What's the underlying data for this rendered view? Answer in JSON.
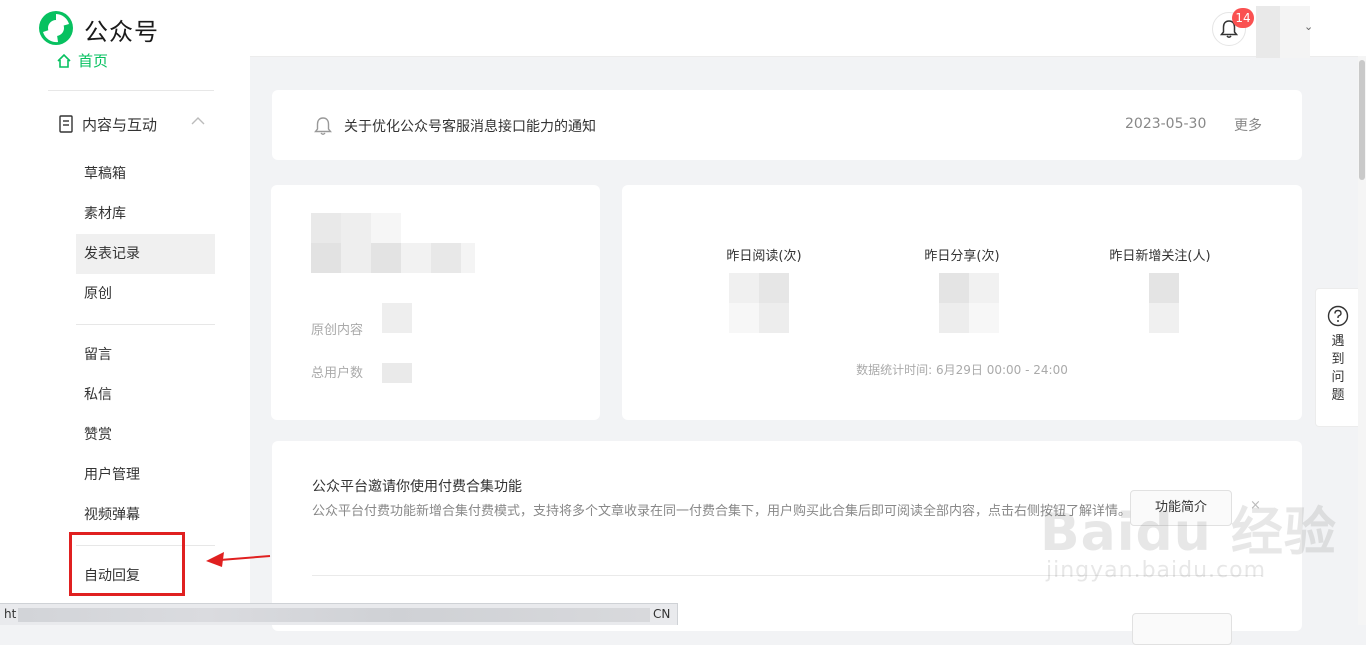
{
  "app": {
    "title": "公众号",
    "brand_color": "#07c160"
  },
  "header": {
    "notification_count": "14"
  },
  "sidebar": {
    "home": "首页",
    "section": "内容与互动",
    "items_group1": [
      "草稿箱",
      "素材库",
      "发表记录",
      "原创"
    ],
    "items_group2": [
      "留言",
      "私信",
      "赞赏",
      "用户管理",
      "视频弹幕"
    ],
    "items_group3": [
      "自动回复"
    ],
    "active_item": "发表记录"
  },
  "notice": {
    "text": "关于优化公众号客服消息接口能力的通知",
    "date": "2023-05-30",
    "more": "更多"
  },
  "profile": {
    "original_label": "原创内容",
    "users_label": "总用户数"
  },
  "stats": {
    "read_label": "昨日阅读(次)",
    "share_label": "昨日分享(次)",
    "follow_label": "昨日新增关注(人)",
    "footer": "数据统计时间: 6月29日 00:00 - 24:00"
  },
  "invite": {
    "title": "公众平台邀请你使用付费合集功能",
    "desc": "公众平台付费功能新增合集付费模式，支持将多个文章收录在同一付费合集下，用户购买此合集后即可阅读全部内容，点击右侧按钮了解详情。",
    "button": "功能简介",
    "close": "×"
  },
  "help": {
    "text": "遇到问题"
  },
  "statusbar": {
    "left": "ht",
    "right": "CN"
  },
  "watermark": {
    "main": "Baidu 经验",
    "sub": "jingyan.baidu.com"
  },
  "icons": [
    "logo-icon",
    "bell-icon",
    "home-icon",
    "document-icon",
    "chevron-up-icon",
    "question-icon",
    "arrow-icon"
  ]
}
